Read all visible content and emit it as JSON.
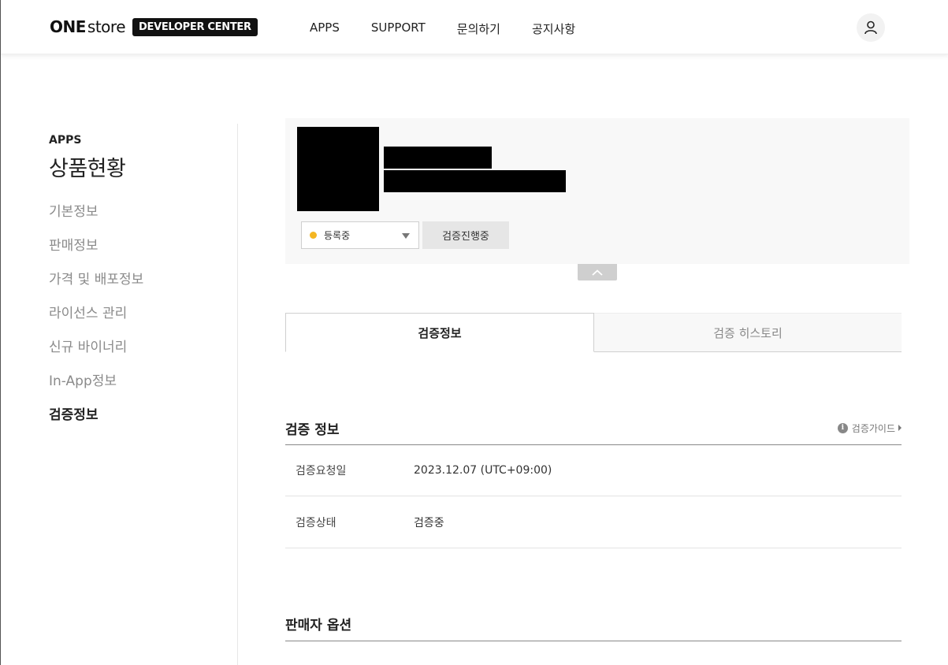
{
  "header": {
    "logo_one": "ONE",
    "logo_store": "store",
    "logo_badge": "DEVELOPER CENTER",
    "nav": [
      "APPS",
      "SUPPORT",
      "문의하기",
      "공지사항"
    ]
  },
  "sidebar": {
    "section": "APPS",
    "title": "상품현황",
    "items": [
      {
        "label": "기본정보",
        "active": false
      },
      {
        "label": "판매정보",
        "active": false
      },
      {
        "label": "가격 및 배포정보",
        "active": false
      },
      {
        "label": "라이선스 관리",
        "active": false
      },
      {
        "label": "신규 바이너리",
        "active": false
      },
      {
        "label": "In-App정보",
        "active": false
      },
      {
        "label": "검증정보",
        "active": true
      }
    ]
  },
  "app_card": {
    "status_value": "등록중",
    "status_color": "#f4b622",
    "verify_button": "검증진행중"
  },
  "tabs": [
    {
      "label": "검증정보",
      "active": true
    },
    {
      "label": "검증 히스토리",
      "active": false
    }
  ],
  "verification": {
    "title": "검증 정보",
    "guide_link": "검증가이드",
    "rows": [
      {
        "label": "검증요청일",
        "value": "2023.12.07 (UTC+09:00)"
      },
      {
        "label": "검증상태",
        "value": "검증중"
      }
    ]
  },
  "seller_options": {
    "title": "판매자 옵션"
  }
}
